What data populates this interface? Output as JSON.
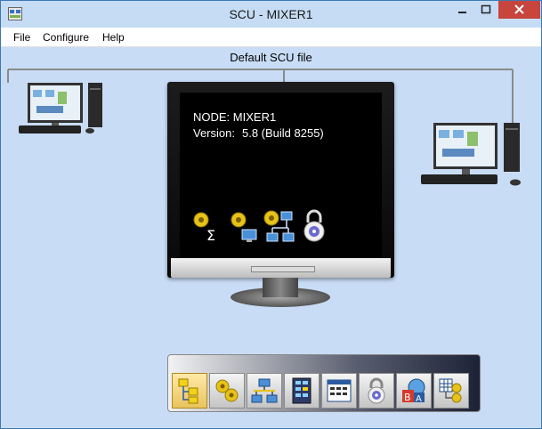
{
  "window": {
    "title": "SCU - MIXER1",
    "icons": {
      "app": "app-icon",
      "minimize": "minimize-icon",
      "maximize": "maximize-icon",
      "close": "close-icon"
    }
  },
  "menu": {
    "items": [
      "File",
      "Configure",
      "Help"
    ]
  },
  "content": {
    "file_label": "Default SCU file"
  },
  "node_info": {
    "node_line": "NODE: MIXER1",
    "version_label": "Version:",
    "version_value": "5.8 (Build 8255)"
  },
  "screen_icons": [
    "alarm-sum-icon",
    "alarm-workstation-icon",
    "network-alarm-icon",
    "security-lock-icon"
  ],
  "toolbar": {
    "buttons": [
      {
        "icon": "node-tree-icon",
        "selected": true
      },
      {
        "icon": "alarm-bells-icon",
        "selected": false
      },
      {
        "icon": "network-icon",
        "selected": false
      },
      {
        "icon": "controller-rack-icon",
        "selected": false
      },
      {
        "icon": "display-window-icon",
        "selected": false
      },
      {
        "icon": "security-lock-icon",
        "selected": false
      },
      {
        "icon": "translate-icon",
        "selected": false
      },
      {
        "icon": "grid-alarm-icon",
        "selected": false
      }
    ]
  },
  "colors": {
    "background": "#c8dcf5",
    "titlebar": "#c5dcf4",
    "close_button": "#c7453c",
    "screen": "#000000",
    "screen_text": "#ffffff"
  }
}
